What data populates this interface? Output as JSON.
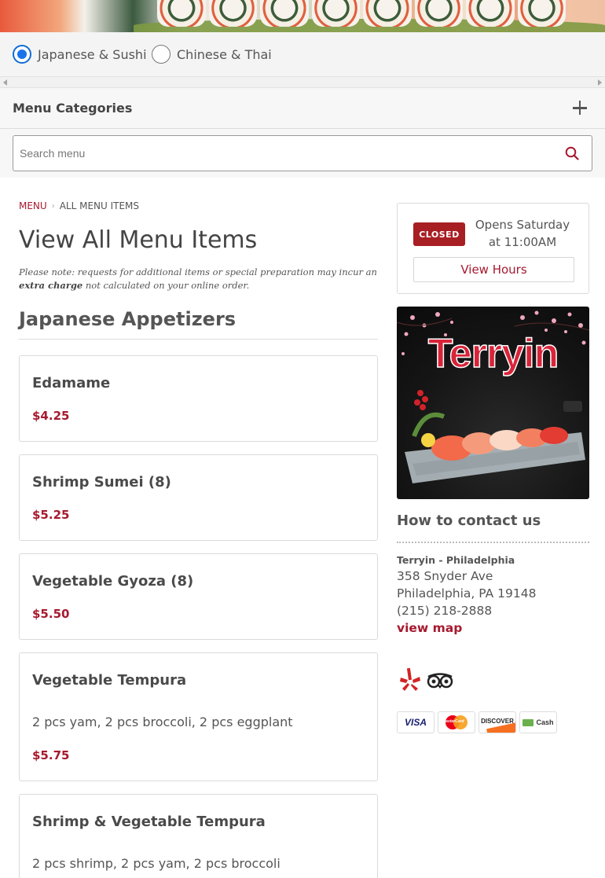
{
  "filters": {
    "options": [
      {
        "label": "Japanese & Sushi",
        "checked": true
      },
      {
        "label": "Chinese & Thai",
        "checked": false
      }
    ]
  },
  "categories": {
    "title": "Menu Categories"
  },
  "search": {
    "placeholder": "Search menu"
  },
  "breadcrumb": {
    "root": "MENU",
    "current": "ALL MENU ITEMS"
  },
  "page": {
    "title": "View All Menu Items",
    "note_before": "Please note: requests for additional items or special preparation may incur an ",
    "note_bold": "extra charge",
    "note_after": " not calculated on your online order."
  },
  "section": {
    "title": "Japanese Appetizers"
  },
  "menu_items": [
    {
      "name": "Edamame",
      "desc": "",
      "price": "$4.25"
    },
    {
      "name": "Shrimp Sumei (8)",
      "desc": "",
      "price": "$5.25"
    },
    {
      "name": "Vegetable Gyoza (8)",
      "desc": "",
      "price": "$5.50"
    },
    {
      "name": "Vegetable Tempura",
      "desc": "2 pcs yam, 2 pcs broccoli, 2 pcs eggplant",
      "price": "$5.75"
    },
    {
      "name": "Shrimp & Vegetable Tempura",
      "desc": "2 pcs shrimp, 2 pcs yam, 2 pcs broccoli",
      "price": ""
    }
  ],
  "status": {
    "badge": "CLOSED",
    "opens_line1": "Opens Saturday",
    "opens_line2": "at 11:00AM",
    "hours_button": "View Hours"
  },
  "promo": {
    "logo_text": "Terryin"
  },
  "contact": {
    "title": "How to contact us",
    "name": "Terryin - Philadelphia",
    "street": "358 Snyder Ave",
    "city": "Philadelphia, PA 19148",
    "phone": "(215) 218-2888",
    "map_link": "view map"
  },
  "payments": [
    {
      "label": "VISA",
      "icon": "visa-icon"
    },
    {
      "label": "MasterCard",
      "icon": "mastercard-icon"
    },
    {
      "label": "DISCOVER",
      "icon": "discover-icon"
    },
    {
      "label": "Cash",
      "icon": "cash-icon"
    }
  ],
  "social": [
    {
      "icon": "yelp-icon"
    },
    {
      "icon": "tripadvisor-icon"
    }
  ],
  "colors": {
    "accent": "#a6192e",
    "badge": "#a81f23",
    "radio": "#1a73e8"
  }
}
